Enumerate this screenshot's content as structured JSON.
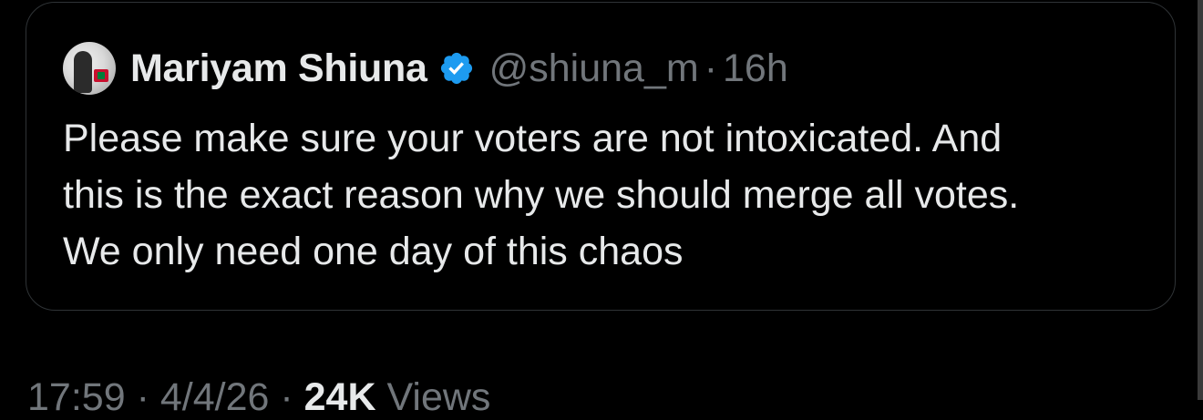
{
  "quoted_tweet": {
    "author_name": "Mariyam Shiuna",
    "handle": "@shiuna_m",
    "separator": "·",
    "timestamp": "16h",
    "lines": [
      "Please make sure your voters are not intoxicated. And",
      "this is the exact reason why we should merge all votes.",
      "We only need one day of this chaos"
    ],
    "verified_badge_icon": "verified-badge-icon",
    "verified_color": "#1d9bf0"
  },
  "footer": {
    "time": "17:59",
    "date_sep": "·",
    "date": "4/4/26",
    "views_sep": "·",
    "views_count": "24K",
    "views_label": "Views"
  },
  "colors": {
    "background": "#000000",
    "text_primary": "#e7e9ea",
    "text_secondary": "#71767b",
    "border": "#2f3336"
  }
}
